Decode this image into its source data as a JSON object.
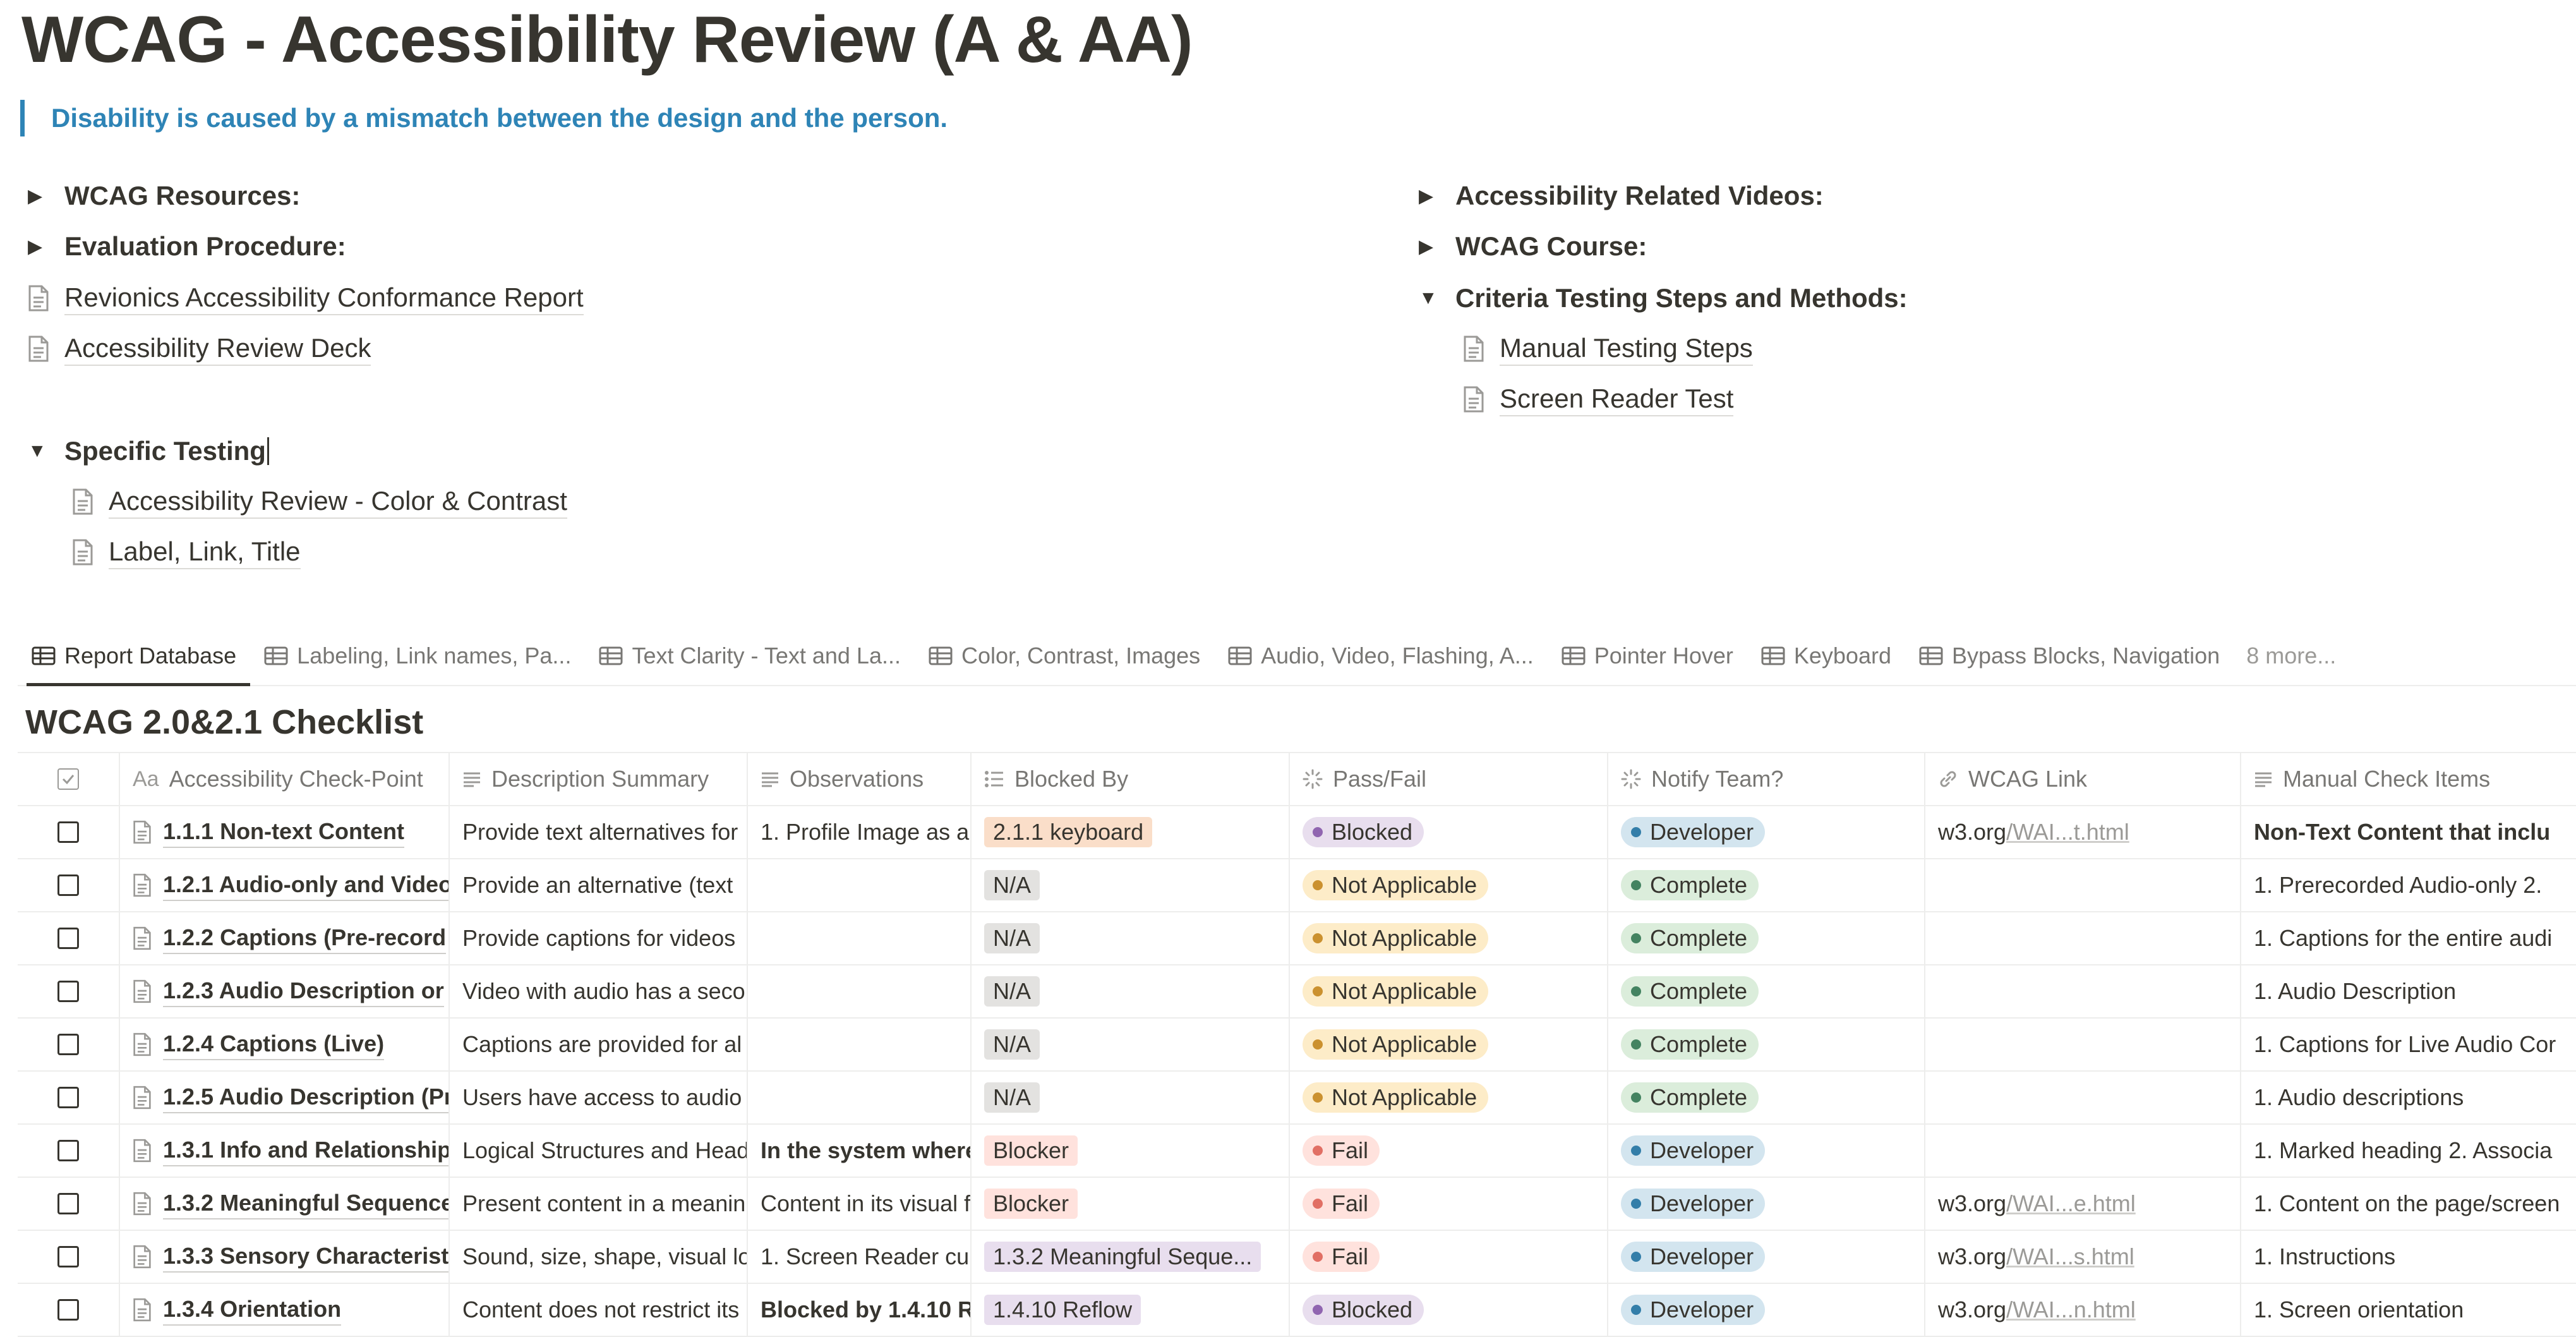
{
  "page": {
    "title": "WCAG - Accessibility Review (A & AA)",
    "quote": "Disability is caused by a mismatch between the design and the person."
  },
  "left_blocks": {
    "wcag_resources": "WCAG Resources:",
    "evaluation_procedure": "Evaluation Procedure:",
    "conformance_report": "Revionics Accessibility Conformance Report",
    "review_deck": "Accessibility Review Deck",
    "specific_testing": "Specific Testing",
    "color_contrast": "Accessibility Review - Color & Contrast",
    "label_link_title": "Label, Link, Title"
  },
  "right_blocks": {
    "videos": "Accessibility Related Videos:",
    "course": "WCAG Course:",
    "criteria_steps": "Criteria Testing Steps and Methods:",
    "manual_steps": "Manual Testing Steps",
    "screen_reader": "Screen Reader Test"
  },
  "tabs": [
    {
      "label": "Report Database"
    },
    {
      "label": "Labeling, Link names, Pa..."
    },
    {
      "label": "Text Clarity - Text and La..."
    },
    {
      "label": "Color, Contrast, Images"
    },
    {
      "label": "Audio, Video, Flashing, A..."
    },
    {
      "label": "Pointer Hover"
    },
    {
      "label": "Keyboard"
    },
    {
      "label": "Bypass Blocks, Navigation"
    }
  ],
  "tabs_more": "8 more...",
  "database": {
    "title": "WCAG 2.0&2.1 Checklist",
    "aa_glyph": "Aa",
    "columns": {
      "checkpoint": "Accessibility Check-Point",
      "description": "Description Summary",
      "observations": "Observations",
      "blocked_by": "Blocked By",
      "pass_fail": "Pass/Fail",
      "notify": "Notify Team?",
      "wcag_link": "WCAG Link",
      "manual": "Manual Check Items"
    },
    "rows": [
      {
        "name": "1.1.1 Non-text Content",
        "desc": "Provide text alternatives for",
        "obs": "1. Profile Image as a",
        "blocked": "2.1.1 keyboard",
        "status": "Blocked",
        "notify": "Developer",
        "link_host": "w3.org",
        "link_rest": "/WAI...t.html",
        "manual": "Non-Text Content that inclu"
      },
      {
        "name": "1.2.1 Audio-only and Video",
        "desc": "Provide an alternative (text",
        "obs": "",
        "blocked": "N/A",
        "status": "Not Applicable",
        "notify": "Complete",
        "link_host": "",
        "link_rest": "",
        "manual": "1. Prerecorded Audio-only 2."
      },
      {
        "name": "1.2.2 Captions (Pre-record",
        "desc": "Provide captions for videos",
        "obs": "",
        "blocked": "N/A",
        "status": "Not Applicable",
        "notify": "Complete",
        "link_host": "",
        "link_rest": "",
        "manual": "1. Captions for the entire audi"
      },
      {
        "name": "1.2.3 Audio Description or",
        "desc": "Video with audio has a seco",
        "obs": "",
        "blocked": "N/A",
        "status": "Not Applicable",
        "notify": "Complete",
        "link_host": "",
        "link_rest": "",
        "manual": "1. Audio Description"
      },
      {
        "name": "1.2.4 Captions (Live)",
        "desc": "Captions are provided for al",
        "obs": "",
        "blocked": "N/A",
        "status": "Not Applicable",
        "notify": "Complete",
        "link_host": "",
        "link_rest": "",
        "manual": "1. Captions for Live Audio Cor"
      },
      {
        "name": "1.2.5 Audio Description (Pr",
        "desc": "Users have access to audio",
        "obs": "",
        "blocked": "N/A",
        "status": "Not Applicable",
        "notify": "Complete",
        "link_host": "",
        "link_rest": "",
        "manual": "1. Audio descriptions"
      },
      {
        "name": "1.3.1 Info and Relationship",
        "desc": "Logical Structures and Head",
        "obs": "In the system where",
        "blocked": "Blocker",
        "status": "Fail",
        "notify": "Developer",
        "link_host": "",
        "link_rest": "",
        "manual": "1. Marked heading 2. Associa"
      },
      {
        "name": "1.3.2 Meaningful Sequence",
        "desc": "Present content in a meanin",
        "obs": "Content in its visual f",
        "blocked": "Blocker",
        "status": "Fail",
        "notify": "Developer",
        "link_host": "w3.org",
        "link_rest": "/WAI...e.html",
        "manual": "1. Content on the page/screen"
      },
      {
        "name": "1.3.3 Sensory Characterist",
        "desc": "Sound, size, shape, visual lo",
        "obs": "1. Screen Reader cu",
        "blocked": "1.3.2 Meaningful Seque...",
        "status": "Fail",
        "notify": "Developer",
        "link_host": "w3.org",
        "link_rest": "/WAI...s.html",
        "manual": "1. Instructions"
      },
      {
        "name": "1.3.4 Orientation",
        "desc": "Content does not restrict its",
        "obs": "Blocked by 1.4.10 R",
        "blocked": "1.4.10 Reflow",
        "status": "Blocked",
        "notify": "Developer",
        "link_host": "w3.org",
        "link_rest": "/WAI...n.html",
        "manual": "1. Screen orientation"
      }
    ]
  },
  "colors": {
    "quote": "#2e84b6",
    "tag_orange_bg": "#fadec9",
    "tag_red_bg": "#ffe2dd",
    "tag_gray_bg": "#e3e2e0",
    "tag_purple_bg": "#e8deee",
    "blocked_bg": "#e8deee",
    "blocked_dot": "#9065b0",
    "na_bg": "#fdecc8",
    "na_dot": "#cb912f",
    "fail_bg": "#ffe2dd",
    "fail_dot": "#e16f64",
    "developer_bg": "#d3e5ef",
    "developer_dot": "#337ea9",
    "complete_bg": "#dbeddb",
    "complete_dot": "#448361"
  },
  "icons": {
    "toggle_closed": "triangle-right-icon",
    "toggle_open": "triangle-down-icon",
    "page": "page-icon",
    "table": "table-view-icon"
  }
}
